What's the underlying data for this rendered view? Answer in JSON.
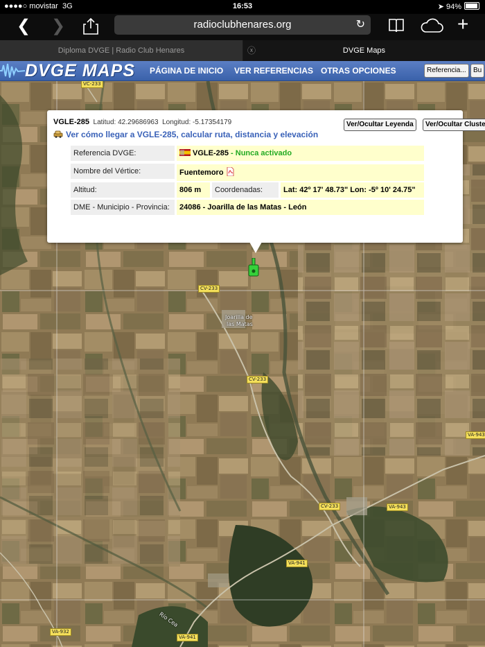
{
  "status": {
    "carrier": "●●●●○ movistar",
    "network": "3G",
    "time": "16:53",
    "battery": "94%",
    "battery_level": 0.94
  },
  "browser": {
    "url": "radioclubhenares.org"
  },
  "tabs": [
    {
      "label": "Diploma DVGE | Radio Club Henares",
      "active": false
    },
    {
      "label": "DVGE Maps",
      "active": true
    }
  ],
  "site": {
    "logo_text": "DVGE MAPS",
    "nav": [
      "PÁGINA DE INICIO",
      "VER REFERENCIAS",
      "OTRAS OPCIONES"
    ],
    "ref_button": "Referencia...",
    "bu_button": "Bu"
  },
  "popup": {
    "ref": "VGLE-285",
    "lat_label": "Latitud:",
    "lat": "42.29686963",
    "lon_label": "Longitud:",
    "lon": "-5.17354179",
    "route_link": "Ver cómo llegar a VGLE-285, calcular ruta, distancia y elevación",
    "btn_legend": "Ver/Ocultar Leyenda",
    "btn_cluster": "Ver/Ocultar Cluste",
    "rows": {
      "ref_label": "Referencia DVGE:",
      "ref_value": "VGLE-285",
      "ref_status": " - Nunca activado",
      "name_label": "Nombre del Vértice:",
      "name_value": "Fuentemoro",
      "alt_label": "Altitud:",
      "alt_value": "806 m",
      "coord_label": "Coordenadas:",
      "coord_value": "Lat: 42º 17' 48.73\" Lon: -5º 10' 24.75\"",
      "dme_label": "DME - Municipio - Provincia:",
      "dme_value": "24086 - Joarilla de las Matas - León"
    }
  },
  "map": {
    "road_labels": [
      "VC-233",
      "CV-233",
      "CV-233",
      "CV-233",
      "VA-943",
      "VA-943",
      "VA-941",
      "VA-932",
      "VA-941"
    ],
    "town_label_1": "Joarilla de",
    "town_label_2": "las Matas",
    "river_label": "Río Cea"
  },
  "colors": {
    "accent": "#3a61aa",
    "status_green": "#22aa22",
    "marker": "#36d13a"
  }
}
